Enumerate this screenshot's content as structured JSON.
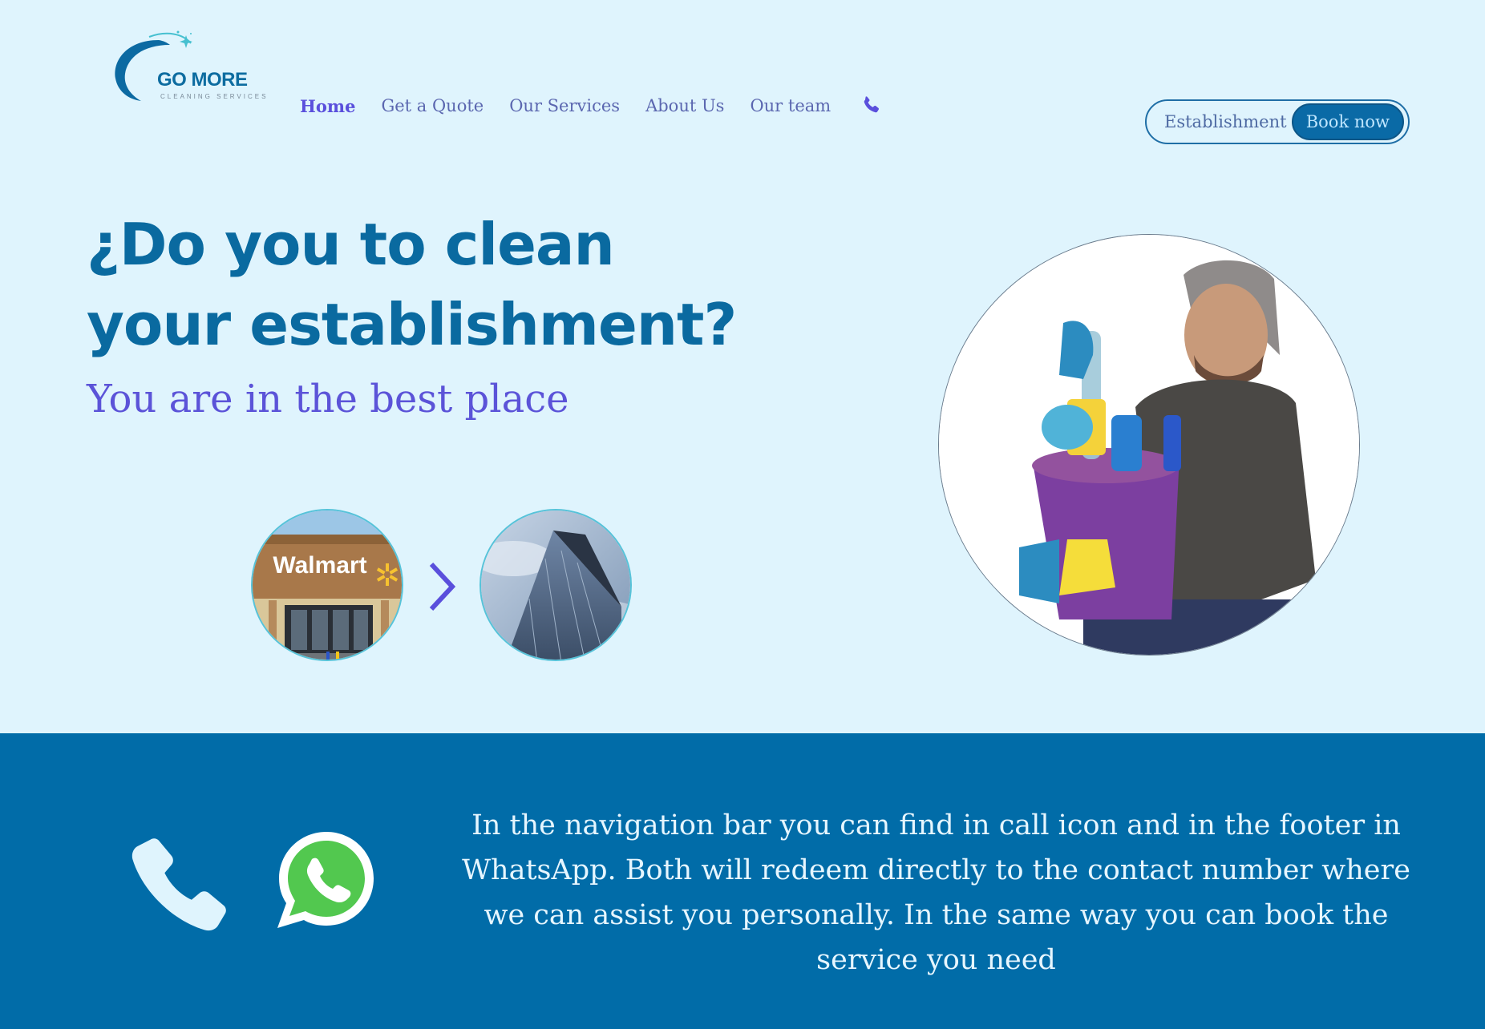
{
  "header": {
    "logo": {
      "name": "GO MORE",
      "tagline": "CLEANING SERVICES"
    },
    "nav": [
      {
        "label": "Home",
        "active": true
      },
      {
        "label": "Get a Quote"
      },
      {
        "label": "Our Services"
      },
      {
        "label": "About Us"
      },
      {
        "label": "Our team"
      }
    ],
    "phone_icon": "phone-icon",
    "cta": {
      "establishment_label": "Establishment",
      "book_label": "Book now"
    }
  },
  "hero": {
    "title_line1": "¿Do you to clean",
    "title_line2": "your establishment?",
    "subtitle": "You are in the best place",
    "thumbs": [
      {
        "name": "walmart-store",
        "sign": "Walmart"
      },
      {
        "name": "glass-tower"
      }
    ],
    "arrow_icon": "chevron-right-icon"
  },
  "contact_band": {
    "icons": [
      "phone-icon",
      "whatsapp-icon"
    ],
    "text": "In the navigation bar you can find in call icon and in the footer in WhatsApp. Both will redeem directly to the contact number where we can assist you personally. In the same way you can book the service you need"
  },
  "colors": {
    "page_bg": "#dff4fd",
    "primary": "#0a6aa0",
    "accent": "#5b53d8",
    "band_bg": "#016ca8"
  }
}
